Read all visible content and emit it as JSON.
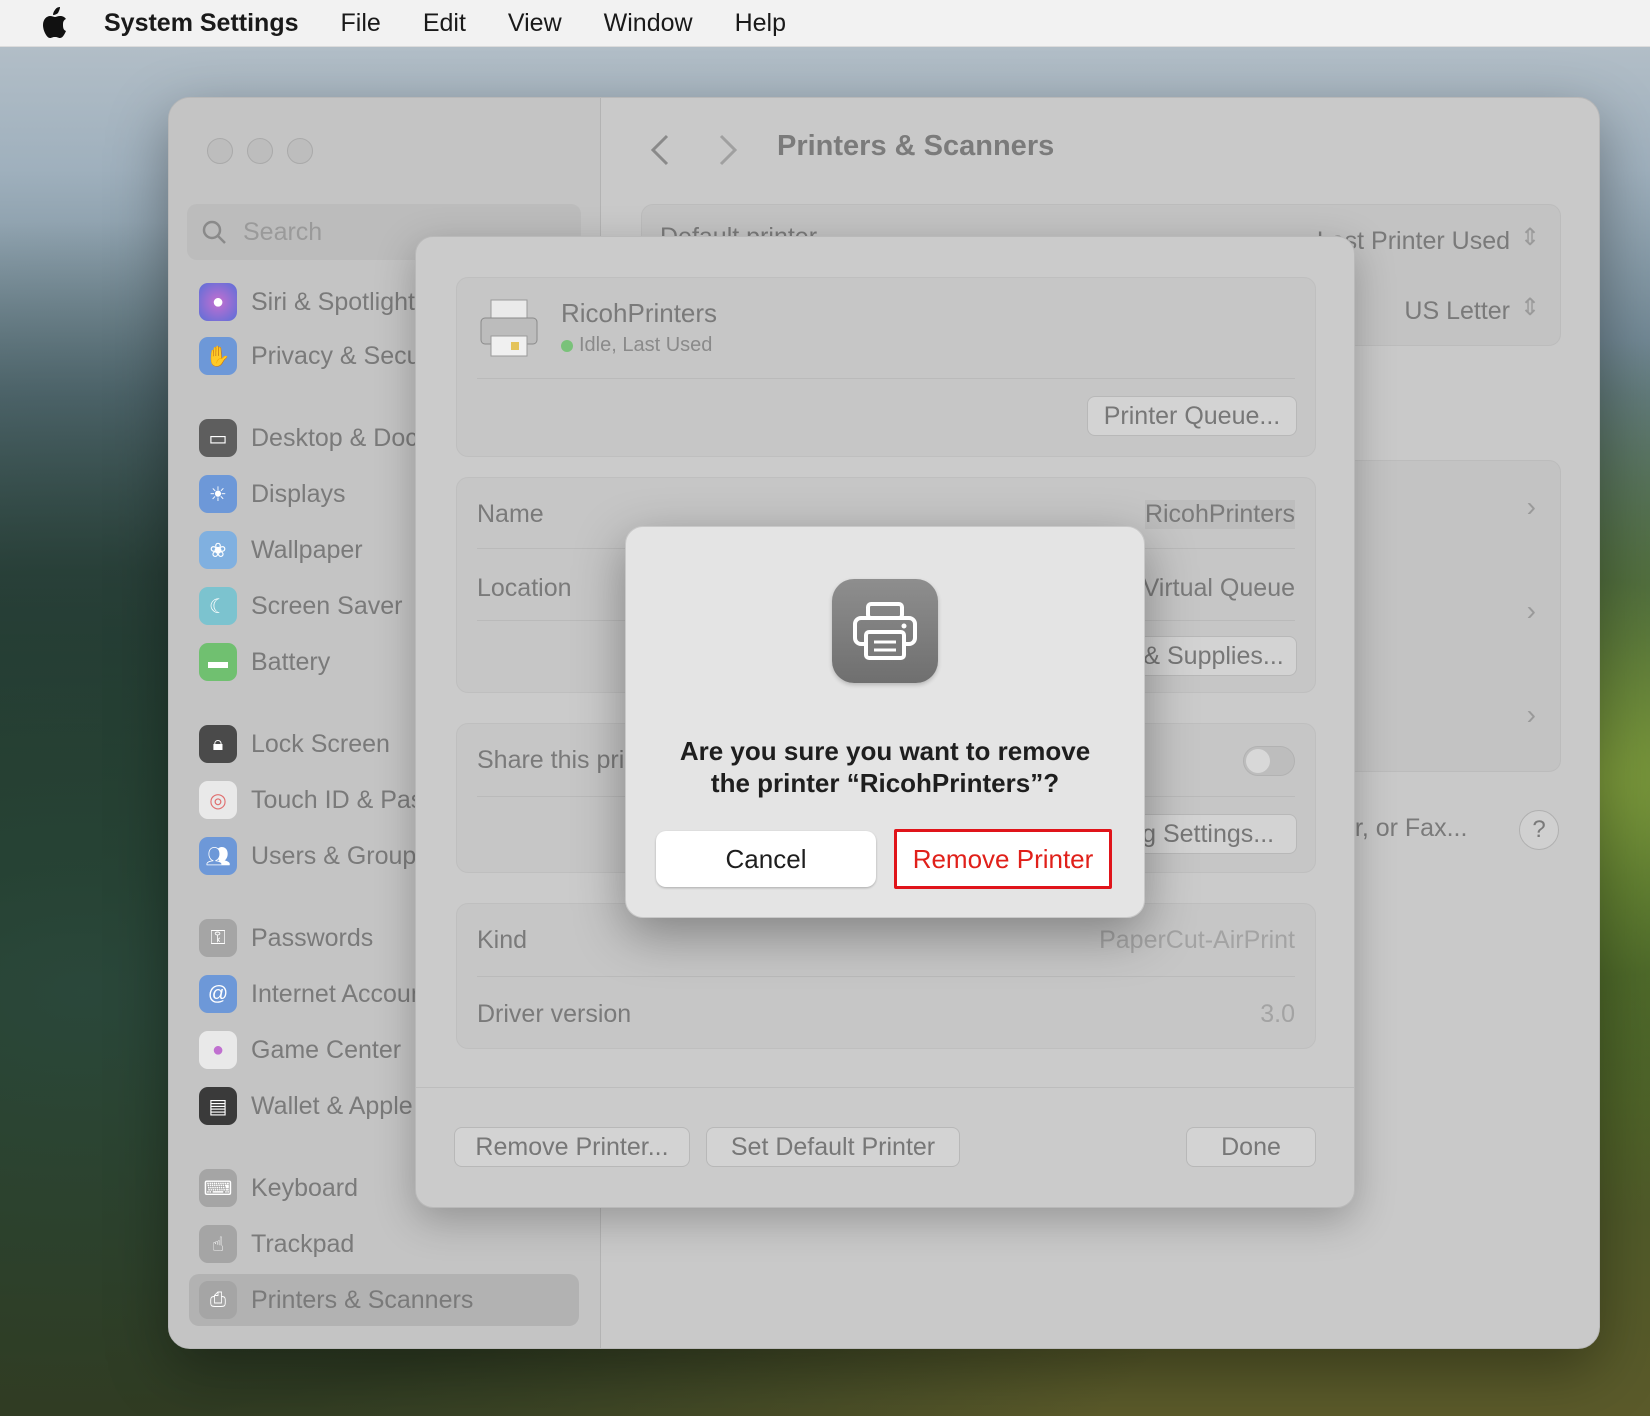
{
  "menubar": {
    "app_name": "System Settings",
    "items": [
      "File",
      "Edit",
      "View",
      "Window",
      "Help"
    ]
  },
  "sidebar": {
    "search_placeholder": "Search",
    "items": [
      {
        "label": "Siri & Spotlight",
        "icon": "siri-icon",
        "color": "#8e6fbf"
      },
      {
        "label": "Privacy & Security",
        "icon": "hand-icon",
        "color": "#5b8fe0"
      },
      {
        "label": "Desktop & Dock",
        "icon": "dock-icon",
        "color": "#555555"
      },
      {
        "label": "Displays",
        "icon": "sun-icon",
        "color": "#5b8fe0"
      },
      {
        "label": "Wallpaper",
        "icon": "flower-icon",
        "color": "#6fa8e8"
      },
      {
        "label": "Screen Saver",
        "icon": "screensaver-icon",
        "color": "#6dc0d0"
      },
      {
        "label": "Battery",
        "icon": "battery-icon",
        "color": "#5fbf5f"
      },
      {
        "label": "Lock Screen",
        "icon": "lock-icon",
        "color": "#444444"
      },
      {
        "label": "Touch ID & Password",
        "icon": "fingerprint-icon",
        "color": "#ffffff"
      },
      {
        "label": "Users & Groups",
        "icon": "users-icon",
        "color": "#5b8fe0"
      },
      {
        "label": "Passwords",
        "icon": "key-icon",
        "color": "#9a9a9a"
      },
      {
        "label": "Internet Accounts",
        "icon": "at-icon",
        "color": "#5b8fe0"
      },
      {
        "label": "Game Center",
        "icon": "gamecenter-icon",
        "color": "#ffffff"
      },
      {
        "label": "Wallet & Apple Pay",
        "icon": "wallet-icon",
        "color": "#333333"
      },
      {
        "label": "Keyboard",
        "icon": "keyboard-icon",
        "color": "#9a9a9a"
      },
      {
        "label": "Trackpad",
        "icon": "trackpad-icon",
        "color": "#9a9a9a"
      },
      {
        "label": "Printers & Scanners",
        "icon": "printer-icon",
        "color": "#9a9a9a"
      }
    ]
  },
  "main": {
    "title": "Printers & Scanners",
    "default_printer_label": "Default printer",
    "default_printer_value": "Last Printer Used",
    "paper_size_value": "US Letter",
    "add_button_partial": "er, or Fax...",
    "help": "?"
  },
  "sheet": {
    "printer_name": "RicohPrinters",
    "printer_status": "Idle, Last Used",
    "printer_queue_button": "Printer Queue...",
    "rows": {
      "name_label": "Name",
      "name_value": "RicohPrinters",
      "location_label": "Location",
      "location_value": "Virtual Queue",
      "supplies_button": "Options & Supplies...",
      "share_label": "Share this printer on the network",
      "sharing_button": "Sharing Settings...",
      "kind_label": "Kind",
      "kind_value": "PaperCut-AirPrint",
      "driver_label": "Driver version",
      "driver_value": "3.0"
    },
    "footer": {
      "remove": "Remove Printer...",
      "set_default": "Set Default Printer",
      "done": "Done"
    }
  },
  "alert": {
    "message_line1": "Are you sure you want to remove",
    "message_line2": "the printer “RicohPrinters”?",
    "cancel": "Cancel",
    "confirm": "Remove Printer",
    "confirm_color": "#e0201a"
  }
}
